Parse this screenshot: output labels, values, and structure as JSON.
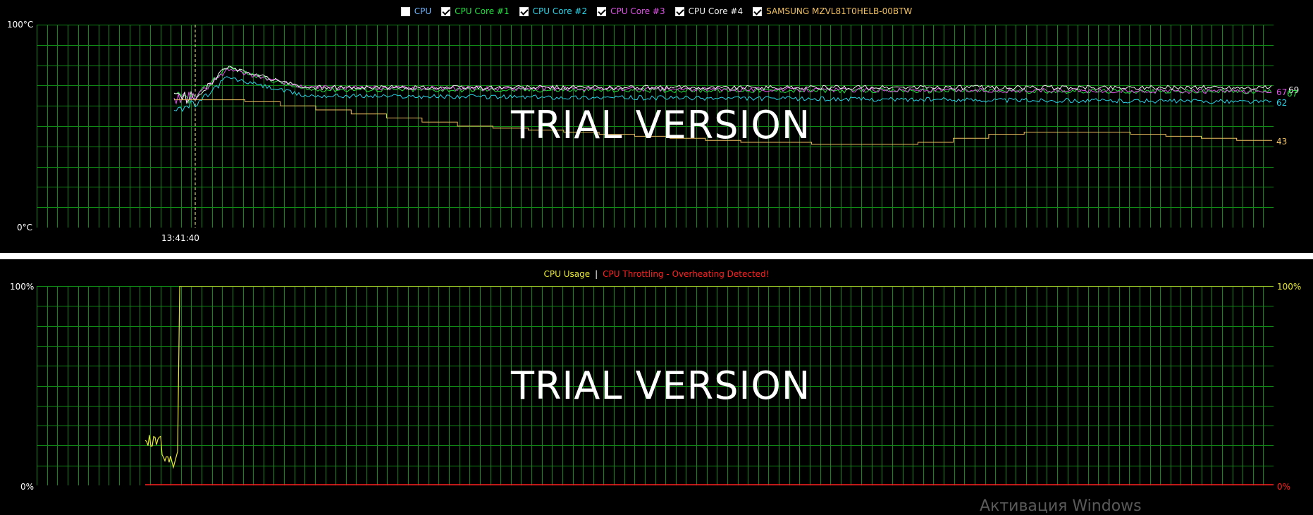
{
  "temperature_panel": {
    "legend": [
      {
        "label": "CPU",
        "checked": false,
        "color": "#6fb7ff"
      },
      {
        "label": "CPU Core #1",
        "checked": true,
        "color": "#22e040"
      },
      {
        "label": "CPU Core #2",
        "checked": true,
        "color": "#2ad4e8"
      },
      {
        "label": "CPU Core #3",
        "checked": true,
        "color": "#e050e8"
      },
      {
        "label": "CPU Core #4",
        "checked": true,
        "color": "#f0f0f0"
      },
      {
        "label": "SAMSUNG MZVL81T0HELB-00BTW",
        "checked": true,
        "color": "#f0c060"
      }
    ],
    "y_max_label": "100°C",
    "y_min_label": "0°C",
    "time_label": "13:41:40",
    "watermark": "TRIAL VERSION",
    "end_values": {
      "core3": "67",
      "core4": "69",
      "core1": "67",
      "core2": "62",
      "ssd": "43"
    }
  },
  "usage_panel": {
    "legend_usage": "CPU Usage",
    "legend_separator": "|",
    "legend_throttle": "CPU Throttling - Overheating Detected!",
    "y_max_left": "100%",
    "y_min_left": "0%",
    "y_max_right": "100%",
    "y_min_right": "0%",
    "watermark": "TRIAL VERSION",
    "activation_text": "Активация Windows"
  },
  "colors": {
    "grid": "#0f8a14",
    "usage": "#e8e830",
    "throttle": "#ff2020",
    "core1": "#22e040",
    "core2": "#2ad4e8",
    "core3": "#e050e8",
    "core4": "#f0f0f0",
    "ssd": "#f0c060"
  },
  "chart_data": [
    {
      "type": "line",
      "title": "",
      "ylim": [
        0,
        100
      ],
      "ylabel_ticks": [
        "0°C",
        "100°C"
      ],
      "x_tick_labels": [
        "13:41:40"
      ],
      "series": [
        {
          "name": "CPU Core #1",
          "start": 64,
          "peak": 79,
          "plateau": 68,
          "end": 67
        },
        {
          "name": "CPU Core #2",
          "start": 60,
          "peak": 74,
          "plateau": 65,
          "end": 62
        },
        {
          "name": "CPU Core #3",
          "start": 64,
          "peak": 78,
          "plateau": 69,
          "end": 67
        },
        {
          "name": "CPU Core #4",
          "start": 64,
          "peak": 79,
          "plateau": 69,
          "end": 69
        },
        {
          "name": "SAMSUNG MZVL81T0HELB-00BTW",
          "points": [
            63,
            63,
            62,
            60,
            58,
            56,
            54,
            52,
            50,
            49,
            48,
            47,
            46,
            45,
            44,
            43,
            42,
            42,
            41,
            41,
            41,
            42,
            44,
            46,
            47,
            47,
            47,
            46,
            45,
            44,
            43
          ]
        }
      ]
    },
    {
      "type": "line",
      "title": "",
      "ylim": [
        0,
        100
      ],
      "ylabel_ticks": [
        "0%",
        "100%"
      ],
      "series": [
        {
          "name": "CPU Usage",
          "initial": 22,
          "dip": 9,
          "plateau": 100
        },
        {
          "name": "CPU Throttling - Overheating Detected!",
          "value": 0
        }
      ]
    }
  ]
}
